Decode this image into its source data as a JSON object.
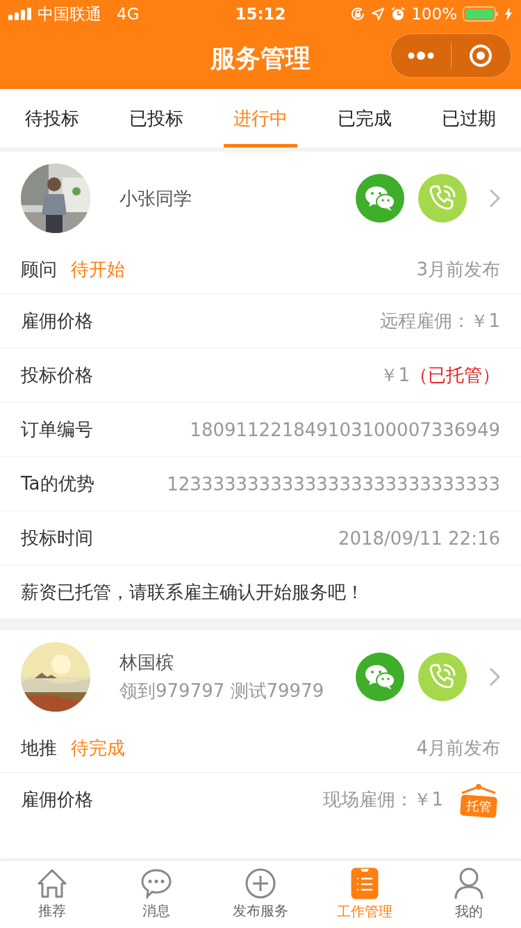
{
  "status_bar": {
    "carrier": "中国联通",
    "network": "4G",
    "time": "15:12",
    "battery": "100%"
  },
  "nav": {
    "title": "服务管理"
  },
  "tabs": [
    {
      "label": "待投标",
      "selected": false
    },
    {
      "label": "已投标",
      "selected": false
    },
    {
      "label": "进行中",
      "selected": true
    },
    {
      "label": "已完成",
      "selected": false
    },
    {
      "label": "已过期",
      "selected": false
    }
  ],
  "orders": [
    {
      "name": "小张同学",
      "role": "顾问",
      "status": "待开始",
      "published": "3月前发布",
      "rows": [
        {
          "label": "雇佣价格",
          "value": "远程雇佣：￥1"
        },
        {
          "label": "投标价格",
          "value": "￥1",
          "note": "（已托管）"
        },
        {
          "label": "订单编号",
          "value": "180911221849103100007336949"
        },
        {
          "label": "Ta的优势",
          "value": "12333333333333333333333333333"
        },
        {
          "label": "投标时间",
          "value": "2018/09/11 22:16"
        }
      ],
      "message": "薪资已托管，请联系雇主确认开始服务吧！"
    },
    {
      "name": "林国槟",
      "subtitle": "领到979797 测试79979",
      "role": "地推",
      "status": "待完成",
      "published": "4月前发布",
      "rows": [
        {
          "label": "雇佣价格",
          "value": "现场雇佣：￥1",
          "badge": "托管"
        }
      ]
    }
  ],
  "bottom_tabs": [
    {
      "label": "推荐",
      "selected": false
    },
    {
      "label": "消息",
      "selected": false
    },
    {
      "label": "发布服务",
      "selected": false
    },
    {
      "label": "工作管理",
      "selected": true
    },
    {
      "label": "我的",
      "selected": false
    }
  ]
}
